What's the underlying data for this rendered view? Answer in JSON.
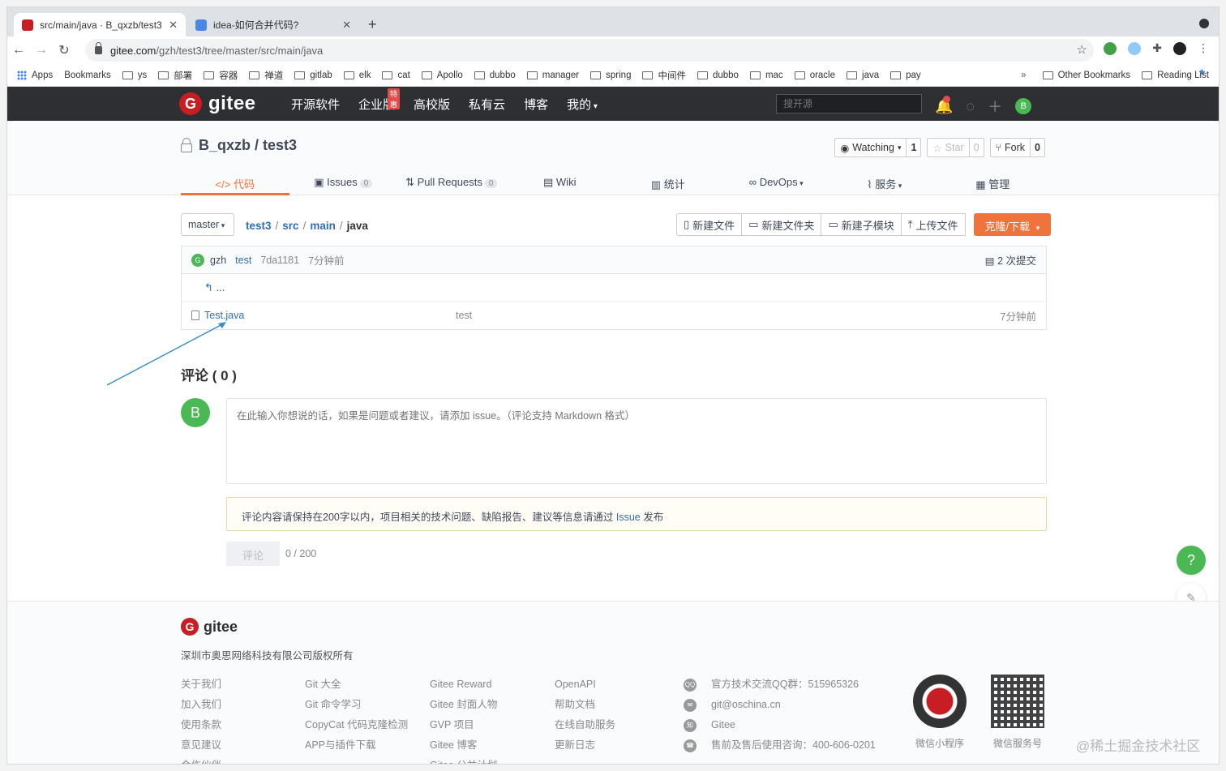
{
  "browser": {
    "tabs": [
      {
        "title": "src/main/java · B_qxzb/test3 · ",
        "active": true,
        "close": "✕"
      },
      {
        "title": "idea-如何合并代码?",
        "active": false,
        "close": "✕"
      }
    ],
    "new_tab": "+",
    "url_host": "gitee.com",
    "url_path": "/gzh/test3/tree/master/src/main/java",
    "bookmarks": [
      "Apps",
      "Bookmarks",
      "ys",
      "部署",
      "容器",
      "禅道",
      "gitlab",
      "elk",
      "cat",
      "Apollo",
      "dubbo",
      "manager",
      "spring",
      "中间件",
      "dubbo",
      "mac",
      "oracle",
      "java",
      "pay"
    ],
    "bookmarks_more": "»",
    "other_bookmarks": "Other Bookmarks",
    "reading_list": "Reading List"
  },
  "gitee_nav": {
    "logo_text": "gitee",
    "items": [
      "开源软件",
      "企业版",
      "高校版",
      "私有云",
      "博客",
      "我的"
    ],
    "hot_badge": "特惠",
    "search_placeholder": "搜开源",
    "avatar_letter": "B"
  },
  "repo": {
    "owner": "B_qxzb",
    "sep": " / ",
    "name": "test3",
    "watching_label": "Watching",
    "watching_count": "1",
    "star_label": "Star",
    "star_count": "0",
    "fork_label": "Fork",
    "fork_count": "0",
    "tabs": [
      {
        "label": "代码",
        "count": ""
      },
      {
        "label": "Issues",
        "count": "0"
      },
      {
        "label": "Pull Requests",
        "count": "0"
      },
      {
        "label": "Wiki",
        "count": ""
      },
      {
        "label": "统计",
        "count": ""
      },
      {
        "label": "DevOps",
        "count": ""
      },
      {
        "label": "服务",
        "count": ""
      },
      {
        "label": "管理",
        "count": ""
      }
    ]
  },
  "browser_view": {
    "branch": "master",
    "path": [
      "test3",
      "src",
      "main",
      "java"
    ],
    "path_sep": "/",
    "file_actions": [
      "新建文件",
      "新建文件夹",
      "新建子模块",
      "上传文件"
    ],
    "clone_label": "克隆/下载",
    "commit": {
      "avatar": "G",
      "author": "gzh",
      "message": "test",
      "hash": "7da1181",
      "time": "7分钟前",
      "total_commits": "2 次提交"
    },
    "up_dir": "...",
    "files": [
      {
        "name": "Test.java",
        "message": "test",
        "time": "7分钟前"
      }
    ]
  },
  "comments": {
    "title": "评论 ( 0 )",
    "avatar_letter": "B",
    "placeholder": "在此输入你想说的话，如果是问题或者建议，请添加 issue。（评论支持 Markdown 格式）",
    "notice_text": "评论内容请保持在200字以内，项目相关的技术问题、缺陷报告、建议等信息请通过 ",
    "notice_link": "Issue",
    "notice_suffix": " 发布",
    "submit_label": "评论",
    "counter": "0 / 200"
  },
  "float_buttons": [
    "?",
    "✎",
    "▭"
  ],
  "footer": {
    "logo_text": "gitee",
    "company": "深圳市奥思网络科技有限公司版权所有",
    "columns": [
      [
        "关于我们",
        "加入我们",
        "使用条款",
        "意见建议",
        "合作伙伴"
      ],
      [
        "Git 大全",
        "Git 命令学习",
        "CopyCat 代码克隆检测",
        "APP与插件下载"
      ],
      [
        "Gitee Reward",
        "Gitee 封面人物",
        "GVP 项目",
        "Gitee 博客",
        "Gitee 公益计划"
      ],
      [
        "OpenAPI",
        "帮助文档",
        "在线自助服务",
        "更新日志"
      ]
    ],
    "contacts": [
      {
        "icon": "QQ",
        "text": "官方技术交流QQ群：515965326"
      },
      {
        "icon": "✉",
        "text": "git@oschina.cn"
      },
      {
        "icon": "知",
        "text": "Gitee"
      },
      {
        "icon": "☎",
        "text": "售前及售后使用咨询：400-606-0201"
      }
    ],
    "qr_labels": [
      "微信小程序",
      "微信服务号"
    ]
  },
  "watermark": "@稀土掘金技术社区",
  "colors": {
    "accent": "#f0733c",
    "brand": "#c71d23",
    "link": "#2f6fb5",
    "green": "#4ab854"
  }
}
